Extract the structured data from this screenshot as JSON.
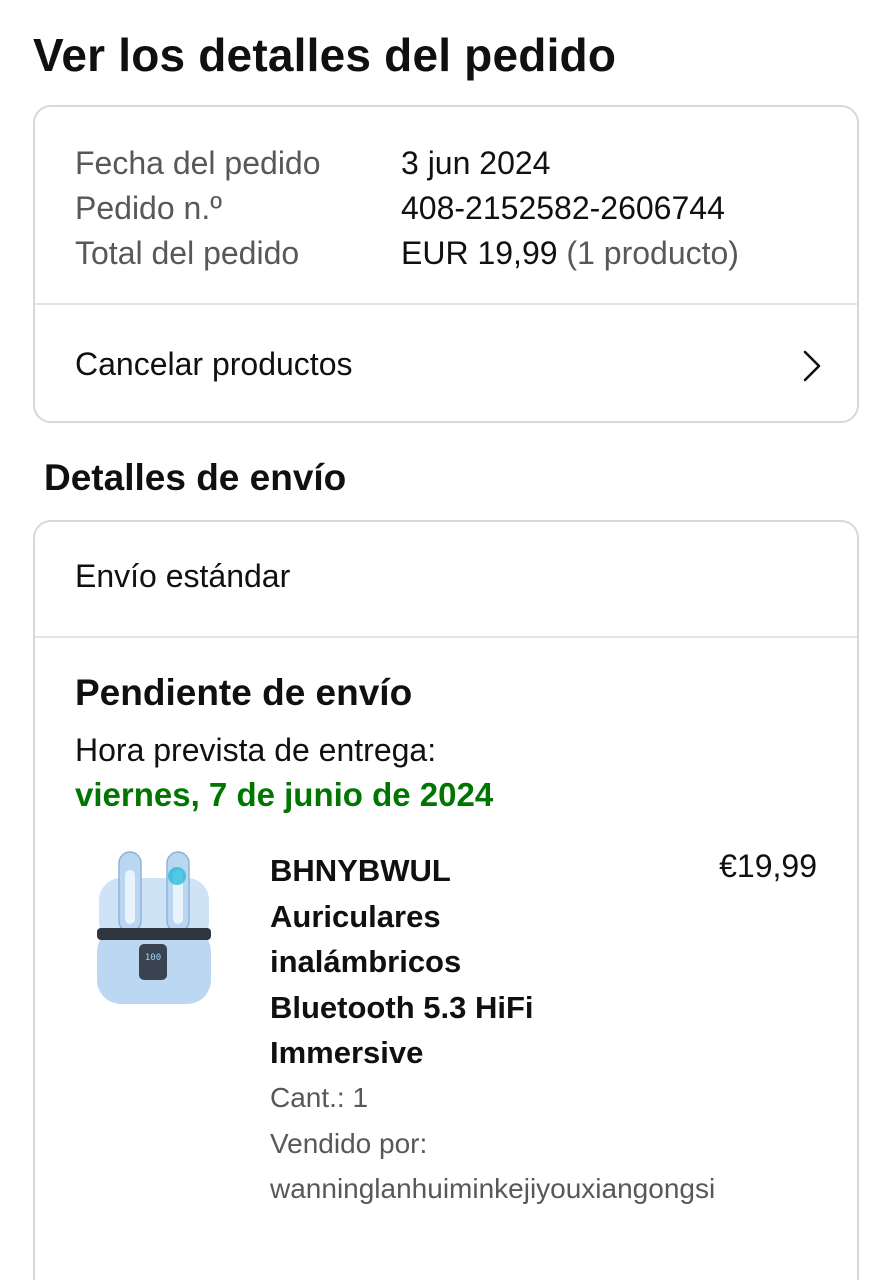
{
  "page": {
    "title": "Ver los detalles del pedido"
  },
  "order_summary": {
    "date_label": "Fecha del pedido",
    "date_value": "3 jun 2024",
    "number_label": "Pedido n.º",
    "number_value": "408-2152582-2606744",
    "total_label": "Total del pedido",
    "total_value": "EUR 19,99",
    "total_count": "(1 producto)"
  },
  "actions": {
    "cancel_label": "Cancelar productos"
  },
  "shipping": {
    "section_title": "Detalles de envío",
    "method": "Envío estándar",
    "status": "Pendiente de envío",
    "eta_label": "Hora prevista de entrega:",
    "eta_date": "viernes, 7 de junio de 2024"
  },
  "product": {
    "title_lines": [
      "BHNYBWUL",
      "Auriculares",
      "inalámbricos",
      "Bluetooth 5.3 HiFi",
      "Immersive"
    ],
    "price": "€19,99",
    "quantity": "Cant.: 1",
    "sold_by_label": "Vendido por:",
    "seller": "wanninglanhuiminkejiyouxiangongsi",
    "image_icon": "earbuds-product-image",
    "case_display": "100"
  },
  "colors": {
    "eta_green": "#007600",
    "border": "#d5d9d9",
    "muted_text": "#565959"
  }
}
